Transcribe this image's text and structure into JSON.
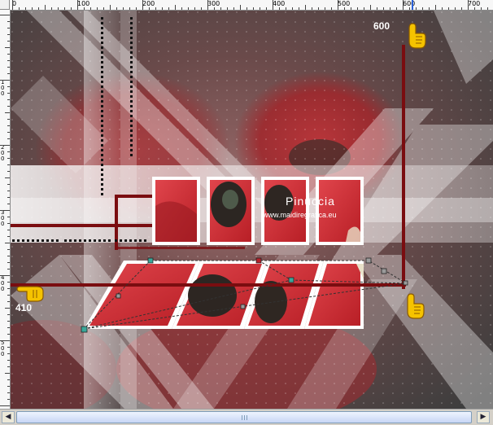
{
  "ruler": {
    "top_labels": [
      "0",
      "100",
      "200",
      "300",
      "400",
      "500",
      "600",
      "700"
    ],
    "left_labels": [
      "1\n0\n0",
      "2\n0\n0",
      "3\n0\n0",
      "4\n0\n0",
      "5\n0\n0"
    ]
  },
  "canvas": {
    "watermark_name": "Pinuccia",
    "watermark_url": "www.maidiregrafica.eu",
    "callouts": {
      "top_right": "600",
      "left": "410"
    }
  },
  "colors": {
    "guide_red": "#7a0d10",
    "frame_white": "#ffffff",
    "node_teal": "#3aa89a",
    "node_red": "#b4202a",
    "ruler_marker": "#2a60d8"
  },
  "icons": {
    "cursor": "pointing-hand-icon"
  }
}
